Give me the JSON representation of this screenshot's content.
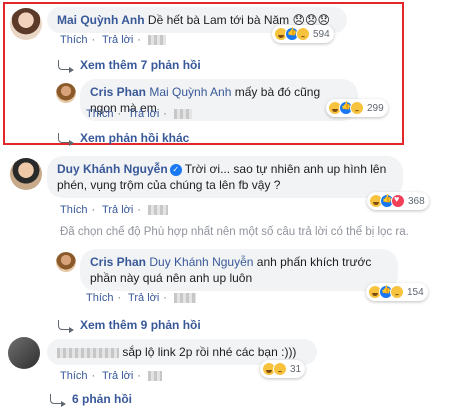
{
  "comments": [
    {
      "author": "Mai Quỳnh Anh",
      "text": "Dề hết bà Lam tới bà Năm",
      "emoji_text": "😞😞😞",
      "like_label": "Thích",
      "reply_label": "Trả lời",
      "reaction_count": "594",
      "view_more_replies": "Xem thêm 7 phản hồi",
      "replies": [
        {
          "author": "Cris Phan",
          "mention": "Mai Quỳnh Anh",
          "text": "mấy bà đó cũng ngon mà em",
          "like_label": "Thích",
          "reply_label": "Trả lời",
          "reaction_count": "299"
        }
      ],
      "view_other_replies": "Xem phản hồi khác"
    },
    {
      "author": "Duy Khánh Nguyễn",
      "text": "Trời ơi... sao tự nhiên anh up hình lên phén, vụng trộm của chúng ta lên fb vậy ?",
      "like_label": "Thích",
      "reply_label": "Trả lời",
      "reaction_count": "368",
      "filter_notice": "Đã chọn chế độ Phù hợp nhất nên một số câu trả lời có thể bị lọc ra.",
      "replies": [
        {
          "author": "Cris Phan",
          "mention": "Duy Khánh Nguyễn",
          "text": "anh phấn khích trước phần này quá nên anh up luôn",
          "like_label": "Thích",
          "reply_label": "Trả lời",
          "reaction_count": "154"
        }
      ],
      "view_more_replies": "Xem thêm 9 phản hồi"
    },
    {
      "text": "sắp lộ link 2p rồi nhé các bạn :)))",
      "like_label": "Thích",
      "reply_label": "Trả lời",
      "reaction_count": "31",
      "view_more_replies": "6 phản hồi"
    }
  ],
  "colors": {
    "highlight": "#e3262a",
    "link": "#385898",
    "bubble": "#f2f3f5"
  }
}
